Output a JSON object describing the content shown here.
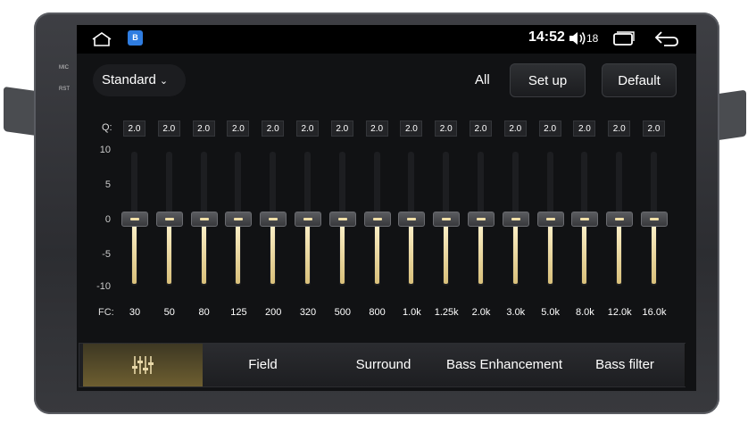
{
  "device": {
    "mic_label": "MIC",
    "rst_label": "RST"
  },
  "statusbar": {
    "time": "14:52",
    "volume": "18",
    "app_icon_letter": "B"
  },
  "toolbar": {
    "preset": "Standard",
    "all_label": "All",
    "setup_label": "Set up",
    "default_label": "Default"
  },
  "eq": {
    "q_label": "Q:",
    "fc_label": "FC:",
    "y_ticks": [
      "10",
      "5",
      "0",
      "-5",
      "-10"
    ],
    "gain_range": [
      -10,
      10
    ],
    "bands": [
      {
        "q": "2.0",
        "fc": "30",
        "gain": 0
      },
      {
        "q": "2.0",
        "fc": "50",
        "gain": 0
      },
      {
        "q": "2.0",
        "fc": "80",
        "gain": 0
      },
      {
        "q": "2.0",
        "fc": "125",
        "gain": 0
      },
      {
        "q": "2.0",
        "fc": "200",
        "gain": 0
      },
      {
        "q": "2.0",
        "fc": "320",
        "gain": 0
      },
      {
        "q": "2.0",
        "fc": "500",
        "gain": 0
      },
      {
        "q": "2.0",
        "fc": "800",
        "gain": 0
      },
      {
        "q": "2.0",
        "fc": "1.0k",
        "gain": 0
      },
      {
        "q": "2.0",
        "fc": "1.25k",
        "gain": 0
      },
      {
        "q": "2.0",
        "fc": "2.0k",
        "gain": 0
      },
      {
        "q": "2.0",
        "fc": "3.0k",
        "gain": 0
      },
      {
        "q": "2.0",
        "fc": "5.0k",
        "gain": 0
      },
      {
        "q": "2.0",
        "fc": "8.0k",
        "gain": 0
      },
      {
        "q": "2.0",
        "fc": "12.0k",
        "gain": 0
      },
      {
        "q": "2.0",
        "fc": "16.0k",
        "gain": 0
      }
    ]
  },
  "tabs": [
    {
      "label": "",
      "icon": "equalizer-icon",
      "active": true
    },
    {
      "label": "Field",
      "active": false
    },
    {
      "label": "Surround",
      "active": false
    },
    {
      "label": "Bass Enhancement",
      "active": false
    },
    {
      "label": "Bass filter",
      "active": false
    }
  ],
  "colors": {
    "accent": "#d9c07a",
    "background": "#111214"
  }
}
